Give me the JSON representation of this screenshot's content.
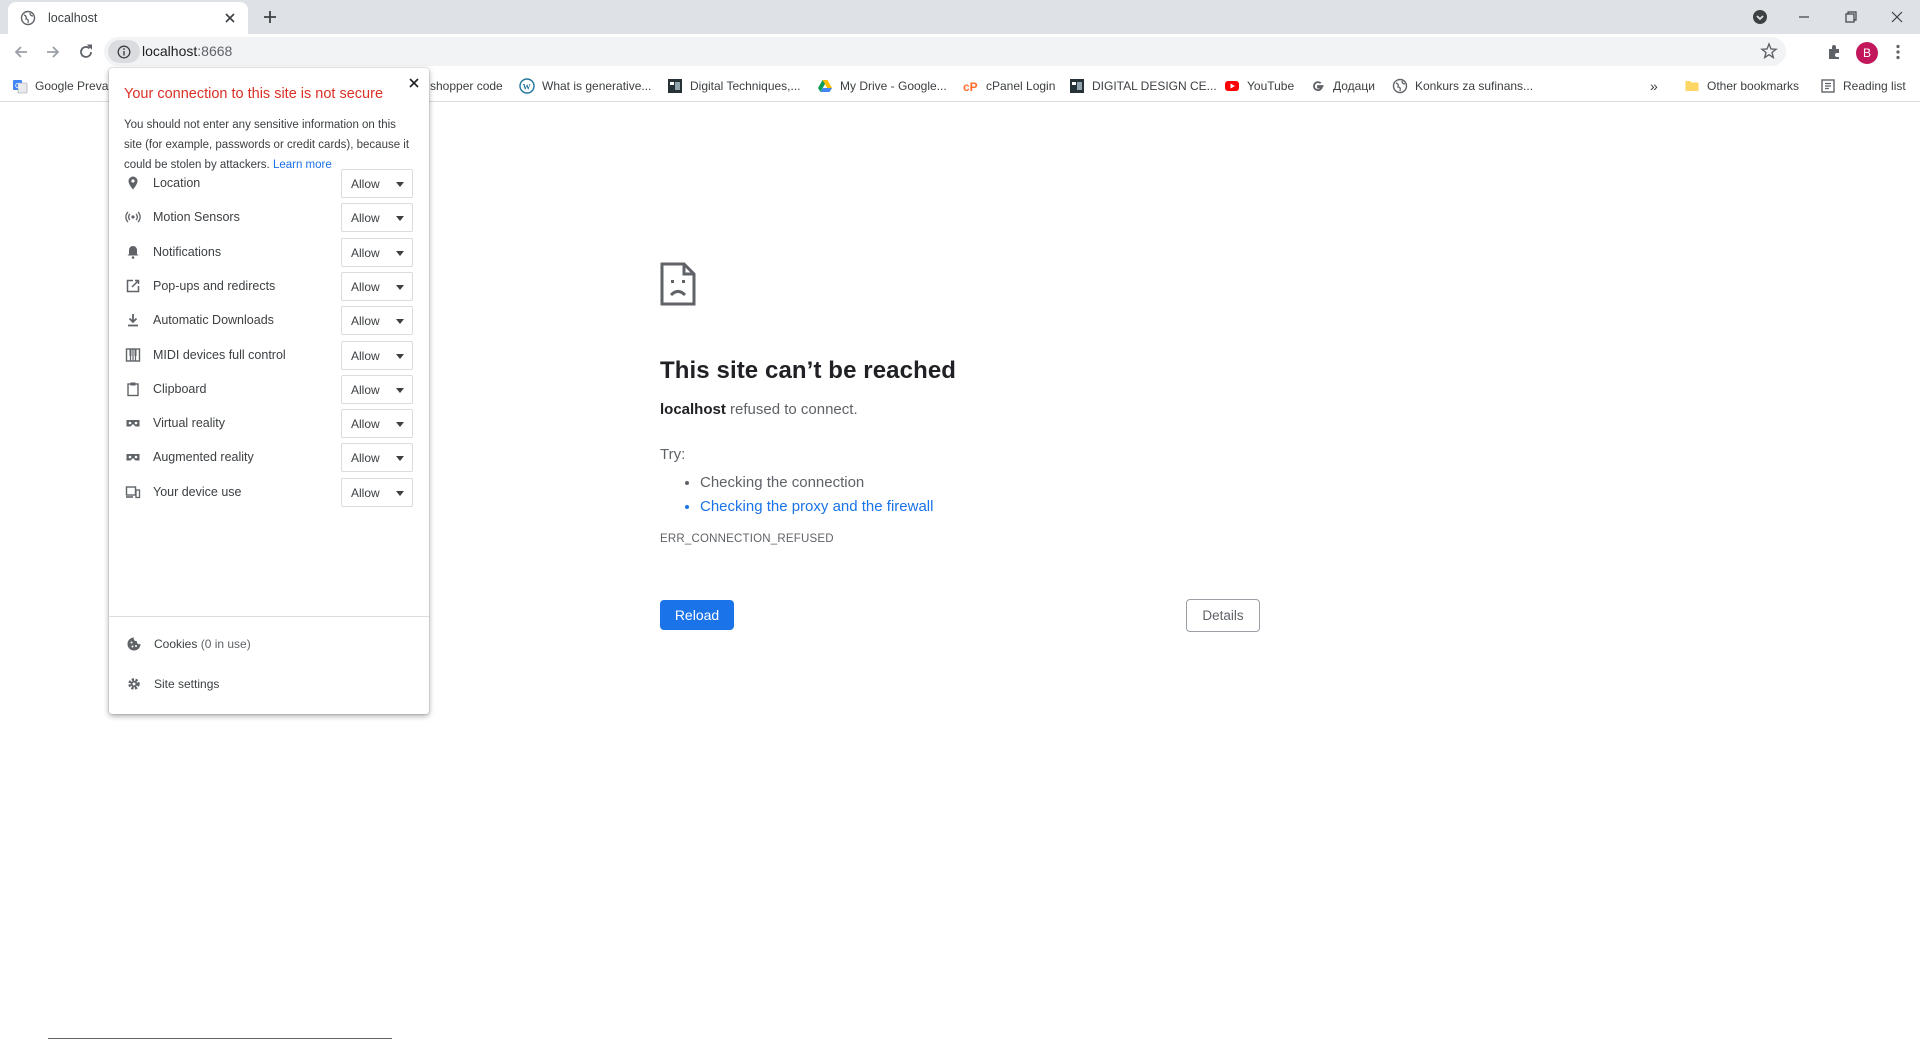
{
  "tab": {
    "title": "localhost",
    "favicon": "globe-icon"
  },
  "omnibox": {
    "host": "localhost",
    "port": ":8668"
  },
  "profile": {
    "initial": "B",
    "color": "#c2185b"
  },
  "bookmarks": [
    {
      "label": "Google Preva",
      "icon": "google-translate-icon"
    },
    {
      "label": "shopper code",
      "icon": "none"
    },
    {
      "label": "What is generative...",
      "icon": "wordpress-icon"
    },
    {
      "label": "Digital Techniques,...",
      "icon": "page-icon"
    },
    {
      "label": "My Drive - Google...",
      "icon": "google-drive-icon"
    },
    {
      "label": "cPanel Login",
      "icon": "cpanel-icon"
    },
    {
      "label": "DIGITAL DESIGN CE...",
      "icon": "page-icon"
    },
    {
      "label": "YouTube",
      "icon": "youtube-icon"
    },
    {
      "label": "Додаци",
      "icon": "google-icon"
    },
    {
      "label": "Konkurs za sufinans...",
      "icon": "globe-icon"
    }
  ],
  "bookmarks_right": {
    "more": "»",
    "other": "Other bookmarks",
    "reading": "Reading list"
  },
  "popup": {
    "heading": "Your connection to this site is not secure",
    "description": "You should not enter any sensitive information on this site (for example, passwords or credit cards), because it could be stolen by attackers.",
    "learn_more": "Learn more",
    "permissions": [
      {
        "label": "Location",
        "value": "Allow",
        "icon": "location-pin-icon"
      },
      {
        "label": "Motion Sensors",
        "value": "Allow",
        "icon": "motion-sensors-icon"
      },
      {
        "label": "Notifications",
        "value": "Allow",
        "icon": "bell-icon"
      },
      {
        "label": "Pop-ups and redirects",
        "value": "Allow",
        "icon": "popup-icon"
      },
      {
        "label": "Automatic Downloads",
        "value": "Allow",
        "icon": "download-icon"
      },
      {
        "label": "MIDI devices full control",
        "value": "Allow",
        "icon": "midi-icon"
      },
      {
        "label": "Clipboard",
        "value": "Allow",
        "icon": "clipboard-icon"
      },
      {
        "label": "Virtual reality",
        "value": "Allow",
        "icon": "vr-headset-icon"
      },
      {
        "label": "Augmented reality",
        "value": "Allow",
        "icon": "ar-headset-icon"
      },
      {
        "label": "Your device use",
        "value": "Allow",
        "icon": "devices-icon"
      }
    ],
    "cookies_label": "Cookies",
    "cookies_sub": "(0 in use)",
    "site_settings": "Site settings"
  },
  "error": {
    "title": "This site can’t be reached",
    "host": "localhost",
    "desc_rest": " refused to connect.",
    "try": "Try:",
    "suggestions": [
      "Checking the connection",
      "Checking the proxy and the firewall"
    ],
    "code": "ERR_CONNECTION_REFUSED",
    "reload": "Reload",
    "details": "Details"
  },
  "colors": {
    "accent": "#1a73e8",
    "warning": "#d93025",
    "tabstrip": "#dee1e6"
  }
}
